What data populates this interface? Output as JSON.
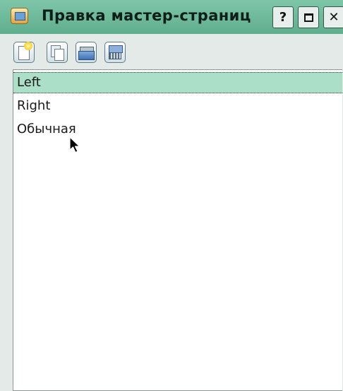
{
  "window": {
    "title": "Правка мастер-страниц",
    "help_label": "?",
    "close_label": "✕"
  },
  "toolbar": {
    "buttons": [
      {
        "icon": "new-page-icon"
      },
      {
        "icon": "duplicate-page-icon"
      },
      {
        "icon": "import-page-icon"
      },
      {
        "icon": "delete-page-icon"
      }
    ]
  },
  "master_pages": {
    "items": [
      {
        "label": "Left",
        "selected": true
      },
      {
        "label": "Right",
        "selected": false
      },
      {
        "label": "Обычная",
        "selected": false
      }
    ]
  },
  "colors": {
    "titlebar": "#6fba9c",
    "selection": "#acdfc8",
    "background": "#e4eae7"
  }
}
